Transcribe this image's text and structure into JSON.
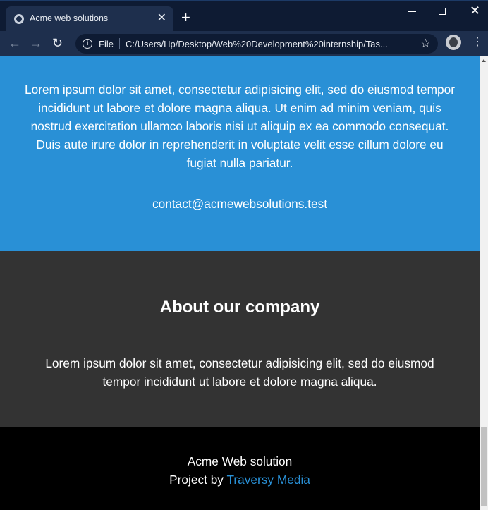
{
  "browser": {
    "tab_title": "Acme web solutions",
    "new_tab": "+",
    "omnibox_scheme": "File",
    "url": "C:/Users/Hp/Desktop/Web%20Development%20internship/Tas..."
  },
  "contact": {
    "text": "Lorem ipsum dolor sit amet, consectetur adipisicing elit, sed do eiusmod tempor incididunt ut labore et dolore magna aliqua. Ut enim ad minim veniam, quis nostrud exercitation ullamco laboris nisi ut aliquip ex ea commodo consequat. Duis aute irure dolor in reprehenderit in voluptate velit esse cillum dolore eu fugiat nulla pariatur.",
    "email": "contact@acmewebsolutions.test"
  },
  "about": {
    "title": "About our company",
    "text": "Lorem ipsum dolor sit amet, consectetur adipisicing elit, sed do eiusmod tempor incididunt ut labore et dolore magna aliqua."
  },
  "footer": {
    "name": "Acme Web solution",
    "credit_prefix": "Project by",
    "credit_link": "Traversy Media"
  },
  "colors": {
    "contact_bg": "#2990d6",
    "about_bg": "#333333",
    "footer_bg": "#000000",
    "link": "#2990d6"
  }
}
